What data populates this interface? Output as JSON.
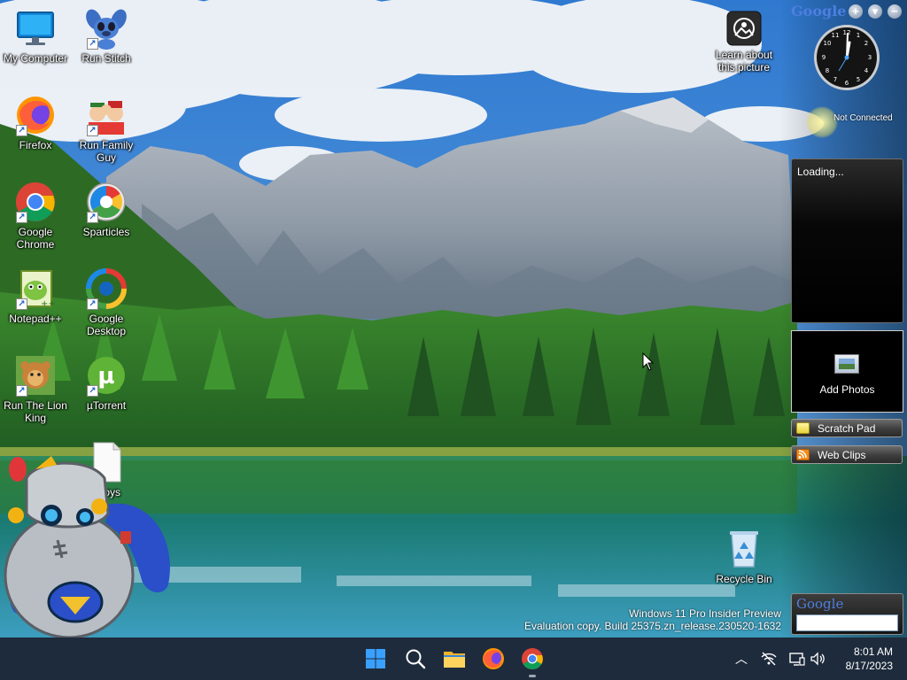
{
  "desktop_icons": [
    {
      "id": "my-computer",
      "label": "My Computer",
      "shortcut": false
    },
    {
      "id": "run-stitch",
      "label": "Run Stitch",
      "shortcut": true
    },
    {
      "id": "firefox",
      "label": "Firefox",
      "shortcut": true
    },
    {
      "id": "run-family-guy",
      "label": "Run Family Guy",
      "shortcut": true
    },
    {
      "id": "google-chrome",
      "label": "Google Chrome",
      "shortcut": true
    },
    {
      "id": "sparticles",
      "label": "Sparticles",
      "shortcut": true
    },
    {
      "id": "notepad-plus-plus",
      "label": "Notepad++",
      "shortcut": true
    },
    {
      "id": "google-desktop",
      "label": "Google Desktop",
      "shortcut": true
    },
    {
      "id": "run-the-lion-king",
      "label": "Run The Lion King",
      "shortcut": true
    },
    {
      "id": "utorrent",
      "label": "µTorrent",
      "shortcut": true
    },
    {
      "id": "partial-file",
      "label": "...toys",
      "shortcut": true
    },
    {
      "id": "learn-about-picture",
      "label": "Learn about this picture",
      "shortcut": false
    },
    {
      "id": "recycle-bin",
      "label": "Recycle Bin",
      "shortcut": false
    }
  ],
  "sidebar": {
    "brand": "Google",
    "controls": [
      "+",
      "▾",
      "−"
    ],
    "weather_status": "Not Connected",
    "feed_status": "Loading...",
    "photos_label": "Add Photos",
    "scratch_pad_label": "Scratch Pad",
    "web_clips_label": "Web Clips",
    "search_logo": "Google",
    "search_value": ""
  },
  "watermark": {
    "line1": "Windows 11 Pro Insider Preview",
    "line2": "Evaluation copy. Build 25375.zn_release.230520-1632"
  },
  "taskbar": {
    "apps": [
      "start-icon",
      "search-icon",
      "file-explorer-icon",
      "firefox-icon",
      "chrome-icon"
    ],
    "tray": [
      "chevron-up-icon",
      "network-disconnected-icon",
      "display-icon",
      "speaker-icon"
    ],
    "time": "8:01 AM",
    "date": "8/17/2023"
  },
  "colors": {
    "taskbar": "#1e2b3c",
    "sky": "#3a7bc8",
    "forest": "#2f7a2a",
    "lake": "#1e7c7a"
  }
}
